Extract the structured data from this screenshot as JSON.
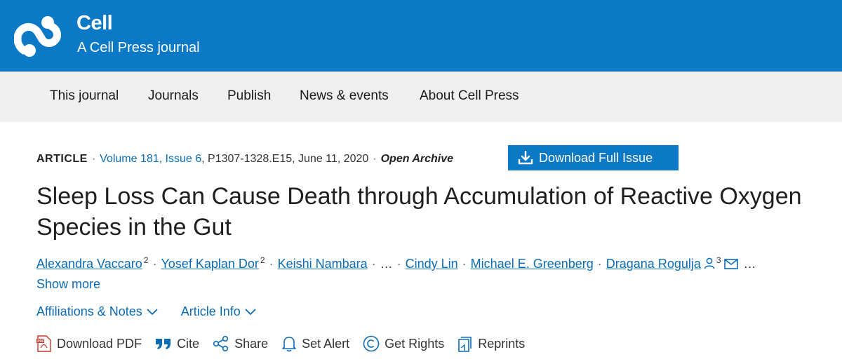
{
  "header": {
    "brand_title": "Cell",
    "brand_subtitle": "A Cell Press journal",
    "brand_color": "#0b79c6"
  },
  "nav": {
    "items": [
      {
        "label": "This journal"
      },
      {
        "label": "Journals"
      },
      {
        "label": "Publish"
      },
      {
        "label": "News & events"
      },
      {
        "label": "About Cell Press"
      }
    ]
  },
  "article_meta": {
    "type": "ARTICLE",
    "volume_issue": "Volume 181, Issue 6",
    "pages": "P1307-1328.E15",
    "date": "June 11, 2020",
    "access": "Open Archive",
    "sep": "·"
  },
  "download_issue_label": "Download Full Issue",
  "title": "Sleep Loss Can Cause Death through Accumulation of Reactive Oxygen Species in the Gut",
  "authors": [
    {
      "name": "Alexandra Vaccaro",
      "sup": "2"
    },
    {
      "name": "Yosef Kaplan Dor",
      "sup": "2"
    },
    {
      "name": "Keishi Nambara",
      "sup": ""
    },
    {
      "name": "Cindy Lin",
      "sup": ""
    },
    {
      "name": "Michael E. Greenberg",
      "sup": ""
    },
    {
      "name": "Dragana Rogulja",
      "sup": "3"
    }
  ],
  "authors_ellipsis": "…",
  "show_more_label": "Show more",
  "expanders": [
    {
      "label": "Affiliations & Notes"
    },
    {
      "label": "Article Info"
    }
  ],
  "actions": [
    {
      "label": "Download PDF",
      "icon": "pdf-icon"
    },
    {
      "label": "Cite",
      "icon": "quote-icon"
    },
    {
      "label": "Share",
      "icon": "share-icon"
    },
    {
      "label": "Set Alert",
      "icon": "bell-icon"
    },
    {
      "label": "Get Rights",
      "icon": "copyright-icon"
    },
    {
      "label": "Reprints",
      "icon": "reprints-icon"
    }
  ]
}
